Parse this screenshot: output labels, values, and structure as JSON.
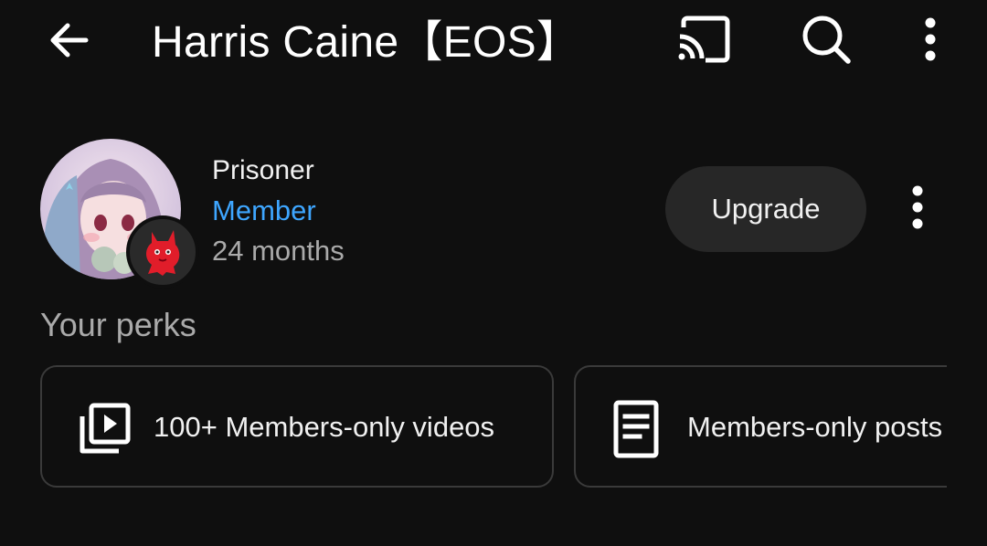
{
  "header": {
    "title": "Harris Caine【EOS】",
    "back_icon": "arrow-left-icon",
    "cast_icon": "cast-icon",
    "search_icon": "search-icon",
    "more_icon": "more-vert-icon"
  },
  "membership": {
    "level_name": "Prisoner",
    "status": "Member",
    "duration": "24 months",
    "upgrade_label": "Upgrade",
    "avatar_icon": "channel-avatar",
    "badge_icon": "member-badge-red-creature-icon",
    "status_color": "#3ea6ff"
  },
  "perks": {
    "heading": "Your perks",
    "items": [
      {
        "label": "100+ Members-only videos",
        "icon": "video-library-icon"
      },
      {
        "label": "Members-only posts",
        "icon": "document-icon"
      }
    ]
  },
  "colors": {
    "background": "#0f0f0f",
    "button_bg": "#272727",
    "card_border": "#3a3a3a",
    "secondary_text": "#aaaaaa"
  }
}
